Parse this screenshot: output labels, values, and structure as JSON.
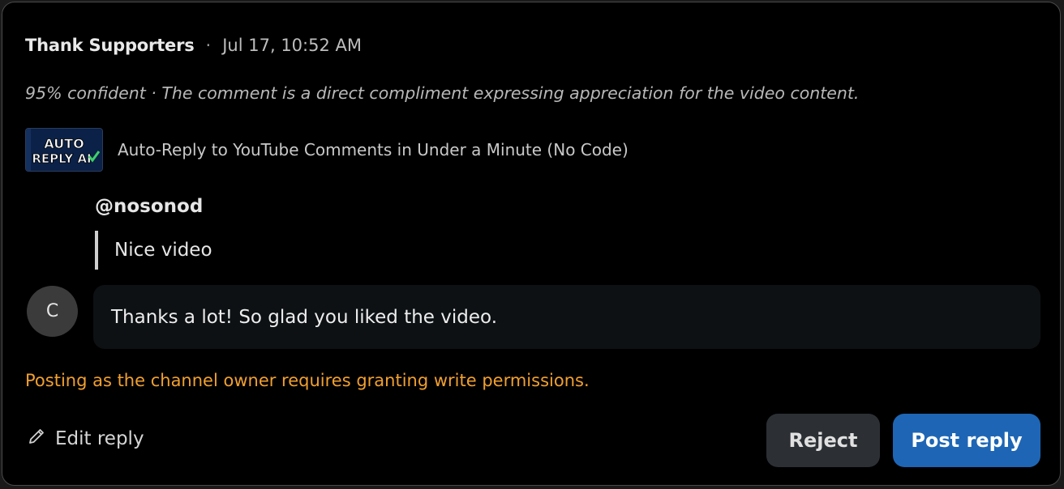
{
  "header": {
    "title": "Thank Supporters",
    "separator": "·",
    "timestamp": "Jul 17, 10:52 AM"
  },
  "confidence_text": "95% confident · The comment is a direct compliment expressing appreciation for the video content.",
  "video": {
    "thumbnail_text_line1": "AUTO",
    "thumbnail_text_line2": "REPLY AI",
    "title": "Auto-Reply to YouTube Comments in Under a Minute (No Code)"
  },
  "comment": {
    "author": "@nosonod",
    "text": "Nice video"
  },
  "reply": {
    "avatar_initial": "C",
    "text": "Thanks a lot! So glad you liked the video."
  },
  "warning": "Posting as the channel owner requires granting write permissions.",
  "actions": {
    "edit_label": "Edit reply",
    "reject_label": "Reject",
    "post_label": "Post reply"
  },
  "colors": {
    "warning": "#f0a030",
    "post_button": "#1e66b5",
    "reject_button": "#2c3034"
  }
}
